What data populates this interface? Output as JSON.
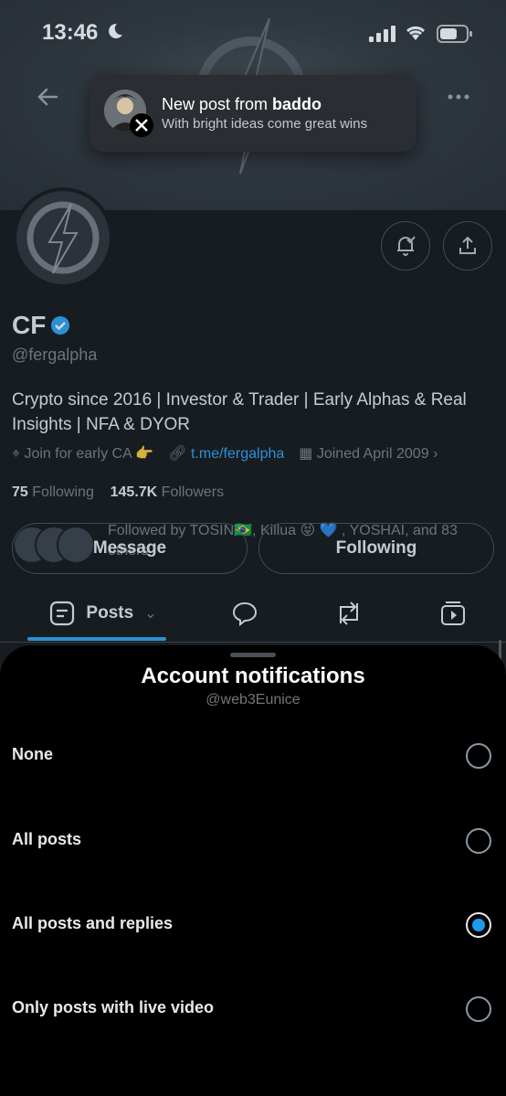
{
  "status_bar": {
    "time": "13:46"
  },
  "toast": {
    "title_prefix": "New post from ",
    "title_user": "baddo",
    "body": "With bright ideas come great wins"
  },
  "profile": {
    "name": "CF",
    "handle": "@fergalpha",
    "bio": "Crypto since 2016 | Investor & Trader | Early Alphas & Real Insights | NFA & DYOR",
    "location": "Join for early CA 👉",
    "link": "t.me/fergalpha",
    "joined": "Joined April 2009",
    "following_count": "75",
    "following_label": "Following",
    "followers_count": "145.7K",
    "followers_label": "Followers",
    "followed_by": "Followed by TOSIN🇧🇷, Killua 😝 💙 , YOSHAI, and 83 others",
    "message_label": "Message",
    "following_button_label": "Following"
  },
  "tabs": {
    "posts_label": "Posts"
  },
  "sheet": {
    "title": "Account notifications",
    "subtitle": "@web3Eunice",
    "options": [
      {
        "label": "None",
        "selected": false
      },
      {
        "label": "All posts",
        "selected": false
      },
      {
        "label": "All posts and replies",
        "selected": true
      },
      {
        "label": "Only posts with live video",
        "selected": false
      }
    ]
  },
  "colors": {
    "accent": "#1d9bf0",
    "sheet_bg": "#000000",
    "toast_bg": "#2a2d31"
  }
}
